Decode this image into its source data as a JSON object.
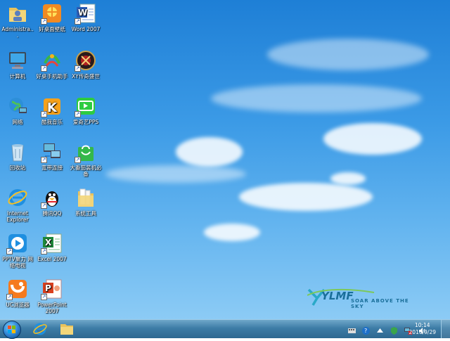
{
  "desktop": {
    "icons": [
      {
        "label": "Administra..."
      },
      {
        "label": "好桌面壁纸"
      },
      {
        "label": "Word 2007"
      },
      {
        "label": "计算机"
      },
      {
        "label": "好桌手机助手"
      },
      {
        "label": "XY传奇盛世"
      },
      {
        "label": "网络"
      },
      {
        "label": "酷我音乐"
      },
      {
        "label": "爱奇艺PPS"
      },
      {
        "label": "回收站"
      },
      {
        "label": "宽带连接"
      },
      {
        "label": "大番茄装机必备"
      },
      {
        "label": "Internet Explorer"
      },
      {
        "label": "腾讯QQ"
      },
      {
        "label": "系统工具"
      },
      {
        "label": "PPTV聚力 网络电视"
      },
      {
        "label": "Excel 2007"
      },
      {
        "label": "UC浏览器"
      },
      {
        "label": "PowerPoint 2007"
      }
    ],
    "logo": {
      "brand": "YLMF",
      "tagline": "SOAR ABOVE THE SKY"
    }
  },
  "taskbar": {
    "clock_time": "10:14",
    "clock_date": "2016/9/29",
    "tray_help": "?"
  },
  "colors": {
    "sky_top": "#1e7fd6",
    "sky_bottom": "#8ccbf5",
    "taskbar": "#3d7ca6",
    "logo": "#1a6f9a"
  }
}
